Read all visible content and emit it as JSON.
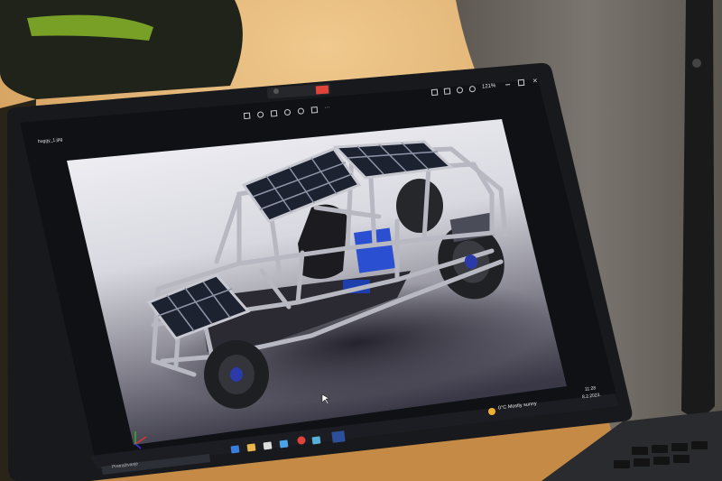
{
  "photo": {
    "subject": "laptop-screen-with-cad-render",
    "colors": {
      "wall": "#d9a35c",
      "chair": "#2a2f22",
      "chair_accent": "#8fbf2a",
      "person_shirt": "#6f6a63",
      "laptop_body": "#1b1c1f",
      "screen_bg": "#0f1115",
      "render_bg_light": "#f2f2f6",
      "render_bg_dark": "#3c3a48",
      "frame": "#b8b8c0",
      "solar_panel": "#1c2230",
      "battery": "#2a4fd0",
      "tire": "#202124",
      "record_indicator": "#e0433a"
    }
  },
  "viewer": {
    "file_name": "buggy_1.jpg",
    "zoom": "121%",
    "toolbar_icons": [
      "edit-icon",
      "rotate-icon",
      "delete-icon",
      "favorite-icon",
      "info-icon",
      "share-icon",
      "more-icon"
    ],
    "window_icons": [
      "expand-icon",
      "fit-icon",
      "zoom-in-icon",
      "zoom-out-icon",
      "minimize-icon",
      "maximize-icon",
      "close-icon"
    ]
  },
  "taskbar": {
    "search_placeholder": "Pretraživanje",
    "weather": "0°C  Mostly sunny",
    "time": "11:28",
    "date": "8.2.2023.",
    "apps": [
      "task-view-icon",
      "edge-icon",
      "file-explorer-icon",
      "store-icon",
      "mail-icon",
      "chrome-icon",
      "app-icon",
      "photos-icon"
    ]
  }
}
